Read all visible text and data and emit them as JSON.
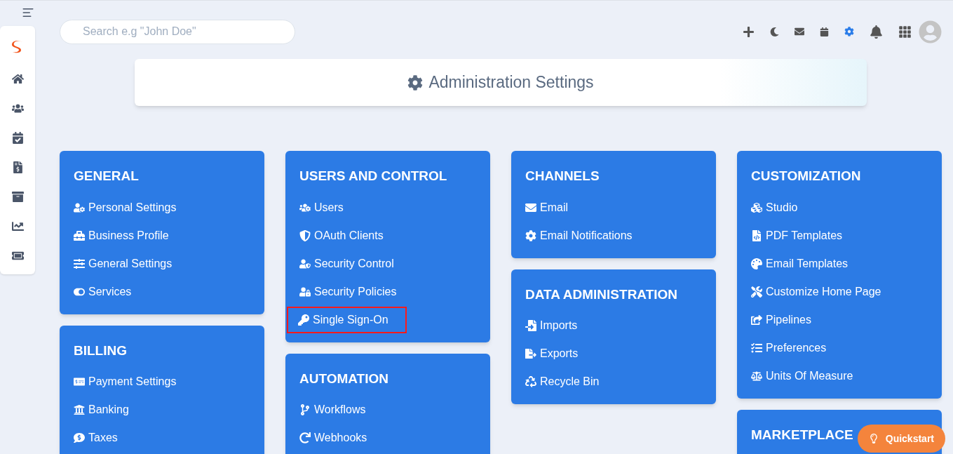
{
  "search": {
    "placeholder": "Search e.g \"John Doe\""
  },
  "header": {
    "title": "Administration Settings"
  },
  "columns": [
    {
      "cards": [
        {
          "title": "GENERAL",
          "items": [
            {
              "label": "Personal Settings",
              "highlighted": false
            },
            {
              "label": "Business Profile",
              "highlighted": false
            },
            {
              "label": "General Settings",
              "highlighted": false
            },
            {
              "label": "Services",
              "highlighted": false
            }
          ]
        },
        {
          "title": "BILLING",
          "items": [
            {
              "label": "Payment Settings",
              "highlighted": false
            },
            {
              "label": "Banking",
              "highlighted": false
            },
            {
              "label": "Taxes",
              "highlighted": false
            }
          ]
        }
      ]
    },
    {
      "cards": [
        {
          "title": "USERS AND CONTROL",
          "items": [
            {
              "label": "Users",
              "highlighted": false
            },
            {
              "label": "OAuth Clients",
              "highlighted": false
            },
            {
              "label": "Security Control",
              "highlighted": false
            },
            {
              "label": "Security Policies",
              "highlighted": false
            },
            {
              "label": "Single Sign-On",
              "highlighted": true
            }
          ]
        },
        {
          "title": "AUTOMATION",
          "items": [
            {
              "label": "Workflows",
              "highlighted": false
            },
            {
              "label": "Webhooks",
              "highlighted": false
            }
          ]
        }
      ]
    },
    {
      "cards": [
        {
          "title": "CHANNELS",
          "items": [
            {
              "label": "Email",
              "highlighted": false
            },
            {
              "label": "Email Notifications",
              "highlighted": false
            }
          ]
        },
        {
          "title": "DATA ADMINISTRATION",
          "items": [
            {
              "label": "Imports",
              "highlighted": false
            },
            {
              "label": "Exports",
              "highlighted": false
            },
            {
              "label": "Recycle Bin",
              "highlighted": false
            }
          ]
        }
      ]
    },
    {
      "cards": [
        {
          "title": "CUSTOMIZATION",
          "items": [
            {
              "label": "Studio",
              "highlighted": false
            },
            {
              "label": "PDF Templates",
              "highlighted": false
            },
            {
              "label": "Email Templates",
              "highlighted": false
            },
            {
              "label": "Customize Home Page",
              "highlighted": false
            },
            {
              "label": "Pipelines",
              "highlighted": false
            },
            {
              "label": "Preferences",
              "highlighted": false
            },
            {
              "label": "Units Of Measure",
              "highlighted": false
            }
          ]
        },
        {
          "title": "MARKETPLACE"
        }
      ]
    }
  ],
  "quickstart": {
    "label": "Quickstart"
  }
}
